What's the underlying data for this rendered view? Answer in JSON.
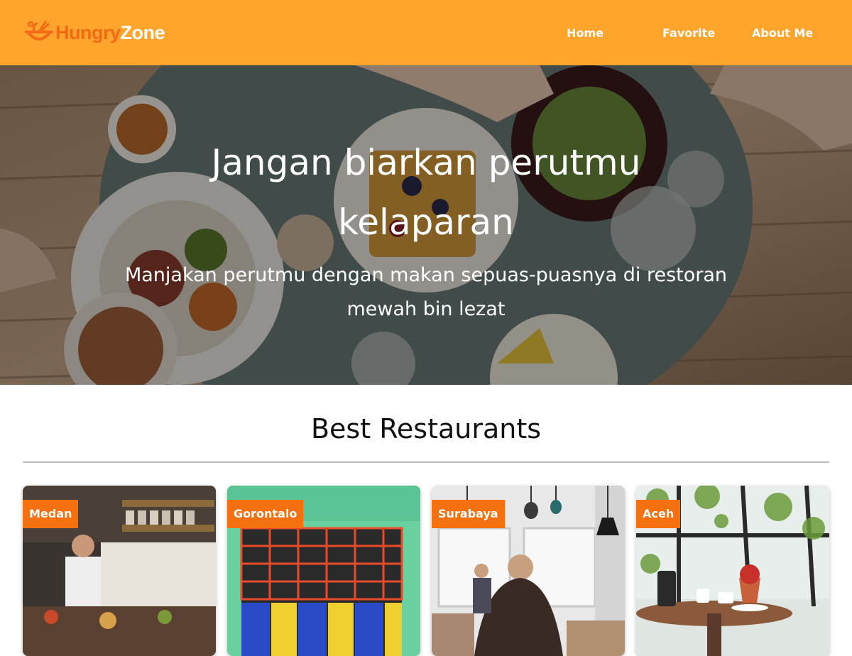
{
  "brand": {
    "name_part1": "Hungry",
    "name_part2": "Zone",
    "header_color": "#ffa42c",
    "accent_color": "#f5700f"
  },
  "nav": {
    "items": [
      {
        "label": "Home"
      },
      {
        "label": "Favorite"
      },
      {
        "label": "About Me"
      }
    ]
  },
  "hero": {
    "title": "Jangan biarkan perutmu kelaparan",
    "subtitle": "Manjakan perutmu dengan makan sepuas-puasnya di restoran mewah bin lezat"
  },
  "section": {
    "title": "Best Restaurants"
  },
  "restaurants": [
    {
      "city": "Medan"
    },
    {
      "city": "Gorontalo"
    },
    {
      "city": "Surabaya"
    },
    {
      "city": "Aceh"
    }
  ]
}
